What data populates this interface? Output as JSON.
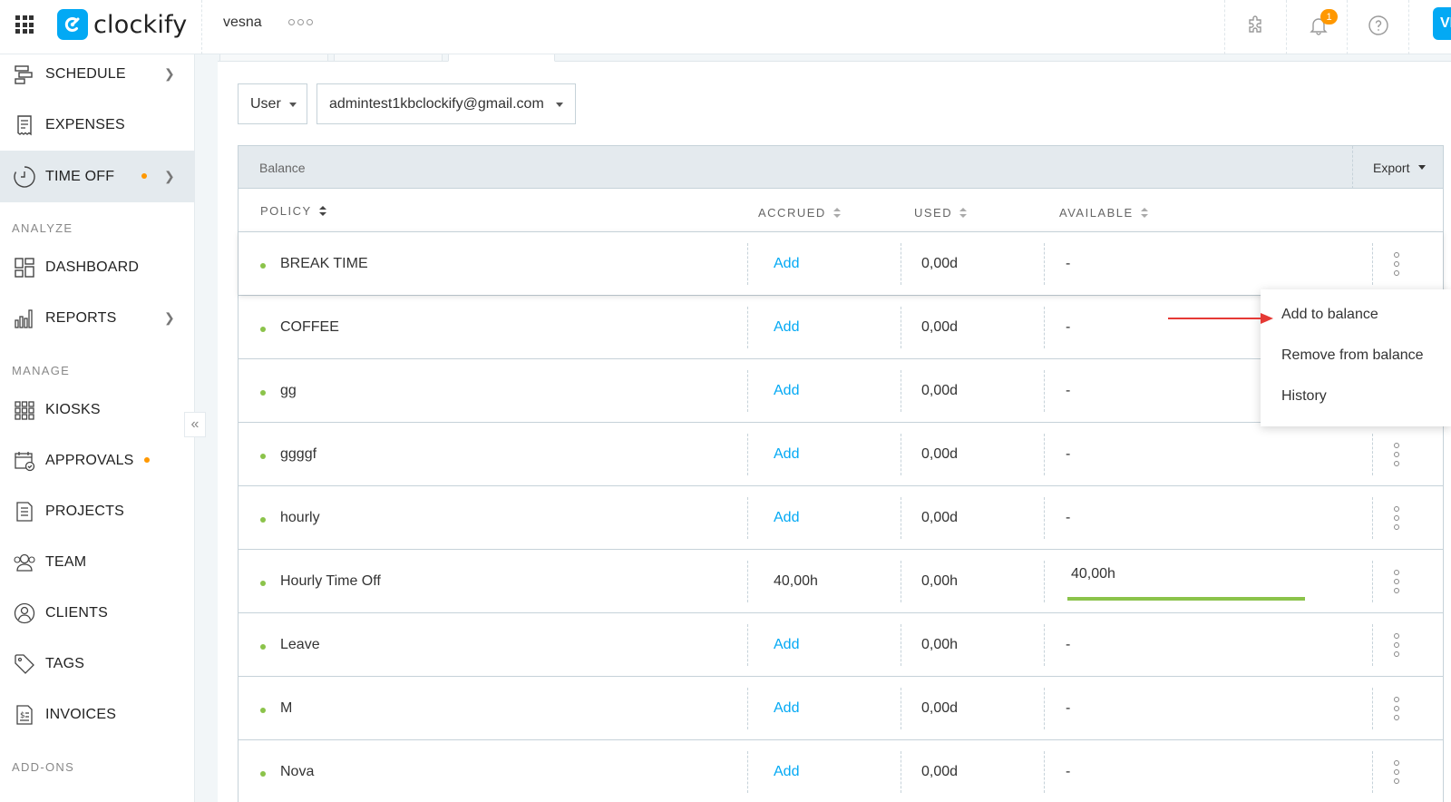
{
  "topbar": {
    "brand": "clockify",
    "workspace": "vesna",
    "notification_count": "1",
    "avatar_initials": "VI",
    "accent": "#03a9f4"
  },
  "sidebar": {
    "items": [
      {
        "label": "SCHEDULE",
        "icon": "schedule-icon"
      },
      {
        "label": "EXPENSES",
        "icon": "receipt-icon"
      },
      {
        "label": "TIME OFF",
        "icon": "clock-icon"
      },
      {
        "label": "DASHBOARD",
        "icon": "dashboard-icon"
      },
      {
        "label": "REPORTS",
        "icon": "bar-chart-icon"
      },
      {
        "label": "KIOSKS",
        "icon": "kiosk-grid-icon"
      },
      {
        "label": "APPROVALS",
        "icon": "calendar-check-icon"
      },
      {
        "label": "PROJECTS",
        "icon": "document-icon"
      },
      {
        "label": "TEAM",
        "icon": "team-icon"
      },
      {
        "label": "CLIENTS",
        "icon": "client-icon"
      },
      {
        "label": "TAGS",
        "icon": "tag-icon"
      },
      {
        "label": "INVOICES",
        "icon": "invoice-icon"
      }
    ],
    "sections": {
      "analyze": "ANALYZE",
      "manage": "MANAGE",
      "addons": "ADD-ONS"
    }
  },
  "filters": {
    "type_value": "User",
    "user_value": "admintest1kbclockify@gmail.com"
  },
  "balance": {
    "title": "Balance",
    "export_label": "Export",
    "columns": {
      "policy": "POLICY",
      "accrued": "ACCRUED",
      "used": "USED",
      "available": "AVAILABLE"
    },
    "rows": [
      {
        "policy": "BREAK TIME",
        "accrued": "Add",
        "used": "0,00d",
        "available": "-"
      },
      {
        "policy": "COFFEE",
        "accrued": "Add",
        "used": "0,00d",
        "available": "-"
      },
      {
        "policy": "gg",
        "accrued": "Add",
        "used": "0,00d",
        "available": "-"
      },
      {
        "policy": "ggggf",
        "accrued": "Add",
        "used": "0,00d",
        "available": "-"
      },
      {
        "policy": "hourly",
        "accrued": "Add",
        "used": "0,00d",
        "available": "-"
      },
      {
        "policy": "Hourly Time Off",
        "accrued": "40,00h",
        "used": "0,00h",
        "available": "40,00h",
        "available_fraction": 1.0
      },
      {
        "policy": "Leave",
        "accrued": "Add",
        "used": "0,00h",
        "available": "-"
      },
      {
        "policy": "M",
        "accrued": "Add",
        "used": "0,00d",
        "available": "-"
      },
      {
        "policy": "Nova",
        "accrued": "Add",
        "used": "0,00d",
        "available": "-"
      }
    ]
  },
  "context_menu": {
    "items": [
      "Add to balance",
      "Remove from balance",
      "History"
    ]
  }
}
